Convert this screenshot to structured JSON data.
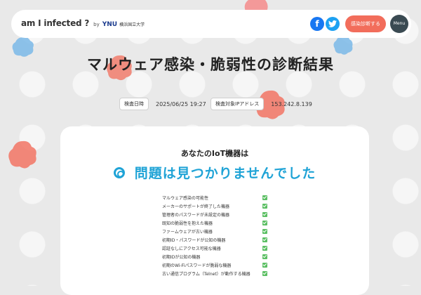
{
  "header": {
    "logo_main": "am I infected ?",
    "logo_by": "by",
    "logo_ynu": "YNU",
    "logo_univ": "横浜国立大学",
    "facebook_icon": "f",
    "twitter_icon": "t",
    "diagnose_button": "感染診断する",
    "menu_button": "Menu"
  },
  "page_title": "マルウェア感染・脆弱性の診断結果",
  "meta": {
    "date_label": "検査日時",
    "date_value": "2025/06/25 19:27",
    "ip_label": "検査対象IPアドレス",
    "ip_value": "153.242.8.139"
  },
  "card": {
    "subtitle": "あなたのIoT機器は",
    "result": "問題は見つかりませんでした",
    "result_color": "#1fa3d6",
    "checklist": [
      {
        "label": "マルウェア感染の可能性",
        "checked": true
      },
      {
        "label": "メーカーのサポートが終了した機器",
        "checked": true
      },
      {
        "label": "管理者のパスワードが未設定の機器",
        "checked": true
      },
      {
        "label": "既知の脆弱性を抱えた機器",
        "checked": true
      },
      {
        "label": "ファームウェアが古い機器",
        "checked": true
      },
      {
        "label": "初期ID・パスワードが公知の機器",
        "checked": true
      },
      {
        "label": "認証なしにアクセス可能な機器",
        "checked": true
      },
      {
        "label": "初期IDが公知の機器",
        "checked": true
      },
      {
        "label": "初期のWi-Fiパスワードが脆弱な機器",
        "checked": true
      },
      {
        "label": "古い通信プログラム（Telnet）が動作する機器",
        "checked": true
      }
    ]
  },
  "colors": {
    "accent_red": "#f26d5b",
    "menu_dark": "#3a4a52",
    "check_green": "#5bbf63",
    "blob_blue": "#7ab8e8"
  }
}
